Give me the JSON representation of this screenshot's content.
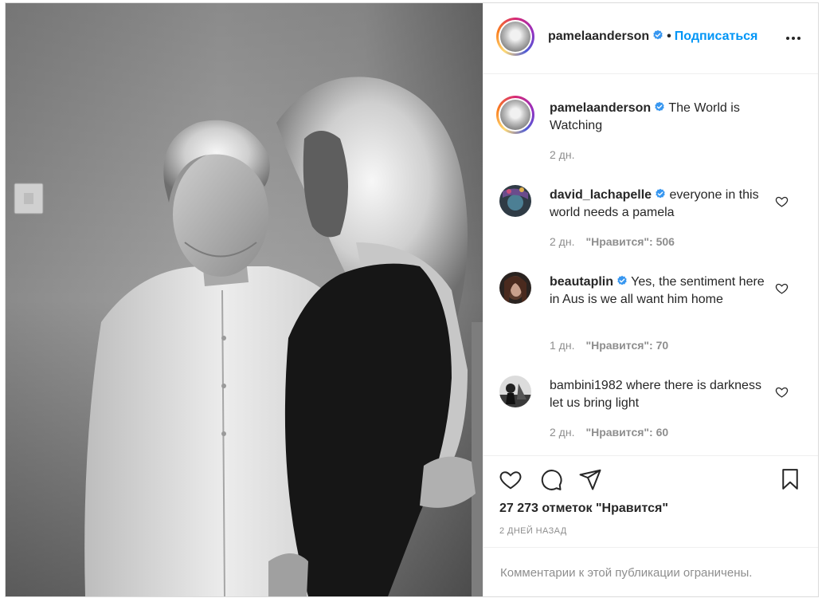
{
  "post": {
    "username": "pamelaanderson",
    "separator": "•",
    "follow_label": "Подписаться"
  },
  "caption": {
    "username": "pamelaanderson",
    "text": "The World is Watching",
    "time": "2 дн."
  },
  "comments": [
    {
      "username": "david_lachapelle",
      "verified": true,
      "text": "everyone in this world needs a pamela",
      "time": "2 дн.",
      "likes": "\"Нравится\": 506"
    },
    {
      "username": "beautaplin",
      "verified": true,
      "text": "Yes, the sentiment here in Aus is we all want him home",
      "time": "1 дн.",
      "likes": "\"Нравится\": 70"
    },
    {
      "username": "bambini1982",
      "verified": false,
      "text": "where there is darkness let us bring light",
      "time": "2 дн.",
      "likes": "\"Нравится\": 60"
    }
  ],
  "stats": {
    "likes": "27 273 отметок \"Нравится\"",
    "date": "2 ДНЕЙ НАЗАД"
  },
  "footer": {
    "restricted_text": "Комментарии к этой публикации ограничены."
  },
  "icons": {
    "verified_color": "#3897f0",
    "link_color": "#0095f6",
    "muted_color": "#8e8e8e"
  }
}
